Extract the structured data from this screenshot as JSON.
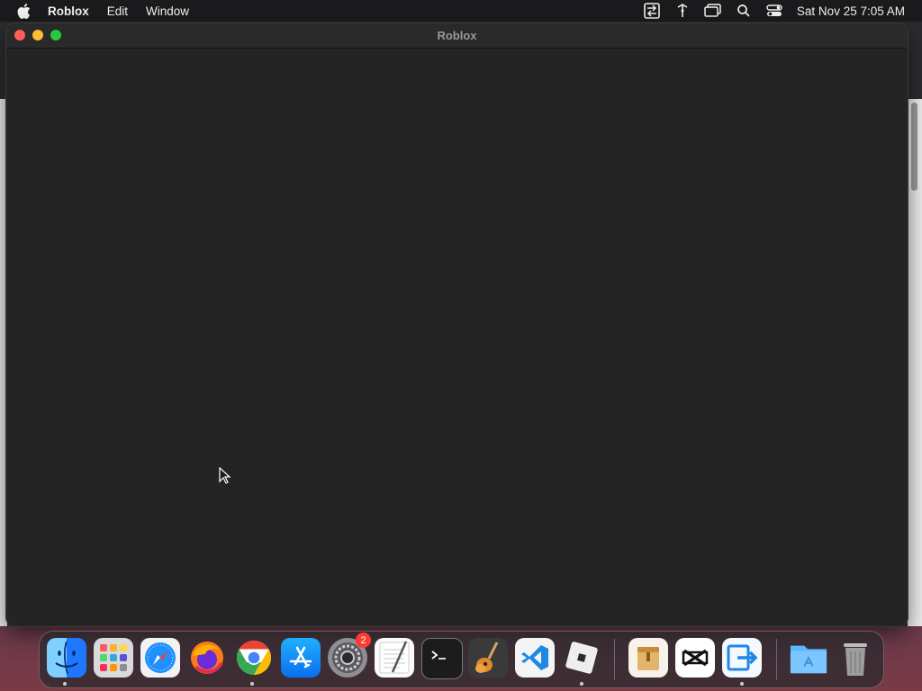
{
  "menubar": {
    "app_name": "Roblox",
    "items": [
      "Edit",
      "Window"
    ],
    "clock": "Sat Nov 25  7:05 AM"
  },
  "window": {
    "title": "Roblox"
  },
  "dock": {
    "apps": [
      {
        "name": "Finder",
        "icon": "finder-icon",
        "running": true
      },
      {
        "name": "Launchpad",
        "icon": "launchpad-icon",
        "running": false
      },
      {
        "name": "Safari",
        "icon": "safari-icon",
        "running": false
      },
      {
        "name": "Firefox",
        "icon": "firefox-icon",
        "running": false
      },
      {
        "name": "Google Chrome",
        "icon": "chrome-icon",
        "running": true
      },
      {
        "name": "App Store",
        "icon": "app-store-icon",
        "running": false
      },
      {
        "name": "System Settings",
        "icon": "system-settings-icon",
        "running": false,
        "badge": "2"
      },
      {
        "name": "TextEdit",
        "icon": "textedit-icon",
        "running": false
      },
      {
        "name": "Terminal",
        "icon": "terminal-icon",
        "running": false
      },
      {
        "name": "GarageBand",
        "icon": "garageband-icon",
        "running": false
      },
      {
        "name": "Visual Studio Code",
        "icon": "vscode-icon",
        "running": false
      },
      {
        "name": "Roblox",
        "icon": "roblox-icon",
        "running": true
      },
      {
        "name": "Archive Utility",
        "icon": "archive-icon",
        "running": false
      },
      {
        "name": "CapCut",
        "icon": "capcut-icon",
        "running": false
      },
      {
        "name": "Migration Assistant",
        "icon": "migration-icon",
        "running": true
      },
      {
        "name": "Applications",
        "icon": "applications-folder-icon",
        "running": false
      },
      {
        "name": "Trash",
        "icon": "trash-icon",
        "running": false
      }
    ]
  }
}
